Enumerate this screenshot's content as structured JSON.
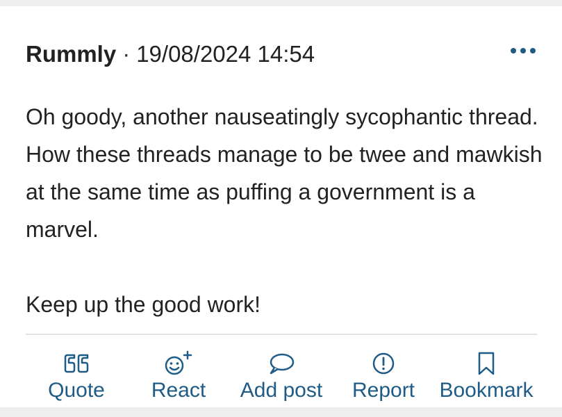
{
  "post": {
    "author": "Rummly",
    "separator": "·",
    "timestamp": "19/08/2024 14:54",
    "paragraphs": [
      "Oh goody, another nauseatingly sycophantic thread. How these threads manage to be twee and mawkish at the same time as puffing a government is a marvel.",
      "Keep up the good work!"
    ],
    "more_icon": "more-options-icon"
  },
  "actions": [
    {
      "label": "Quote",
      "icon": "quote-icon"
    },
    {
      "label": "React",
      "icon": "react-icon"
    },
    {
      "label": "Add post",
      "icon": "speech-bubble-icon"
    },
    {
      "label": "Report",
      "icon": "report-icon"
    },
    {
      "label": "Bookmark",
      "icon": "bookmark-icon"
    }
  ],
  "colors": {
    "accent": "#1e5b86",
    "text": "#222222",
    "background": "#ffffff",
    "page_background": "#eeeeee",
    "divider": "#e2e2e2"
  }
}
